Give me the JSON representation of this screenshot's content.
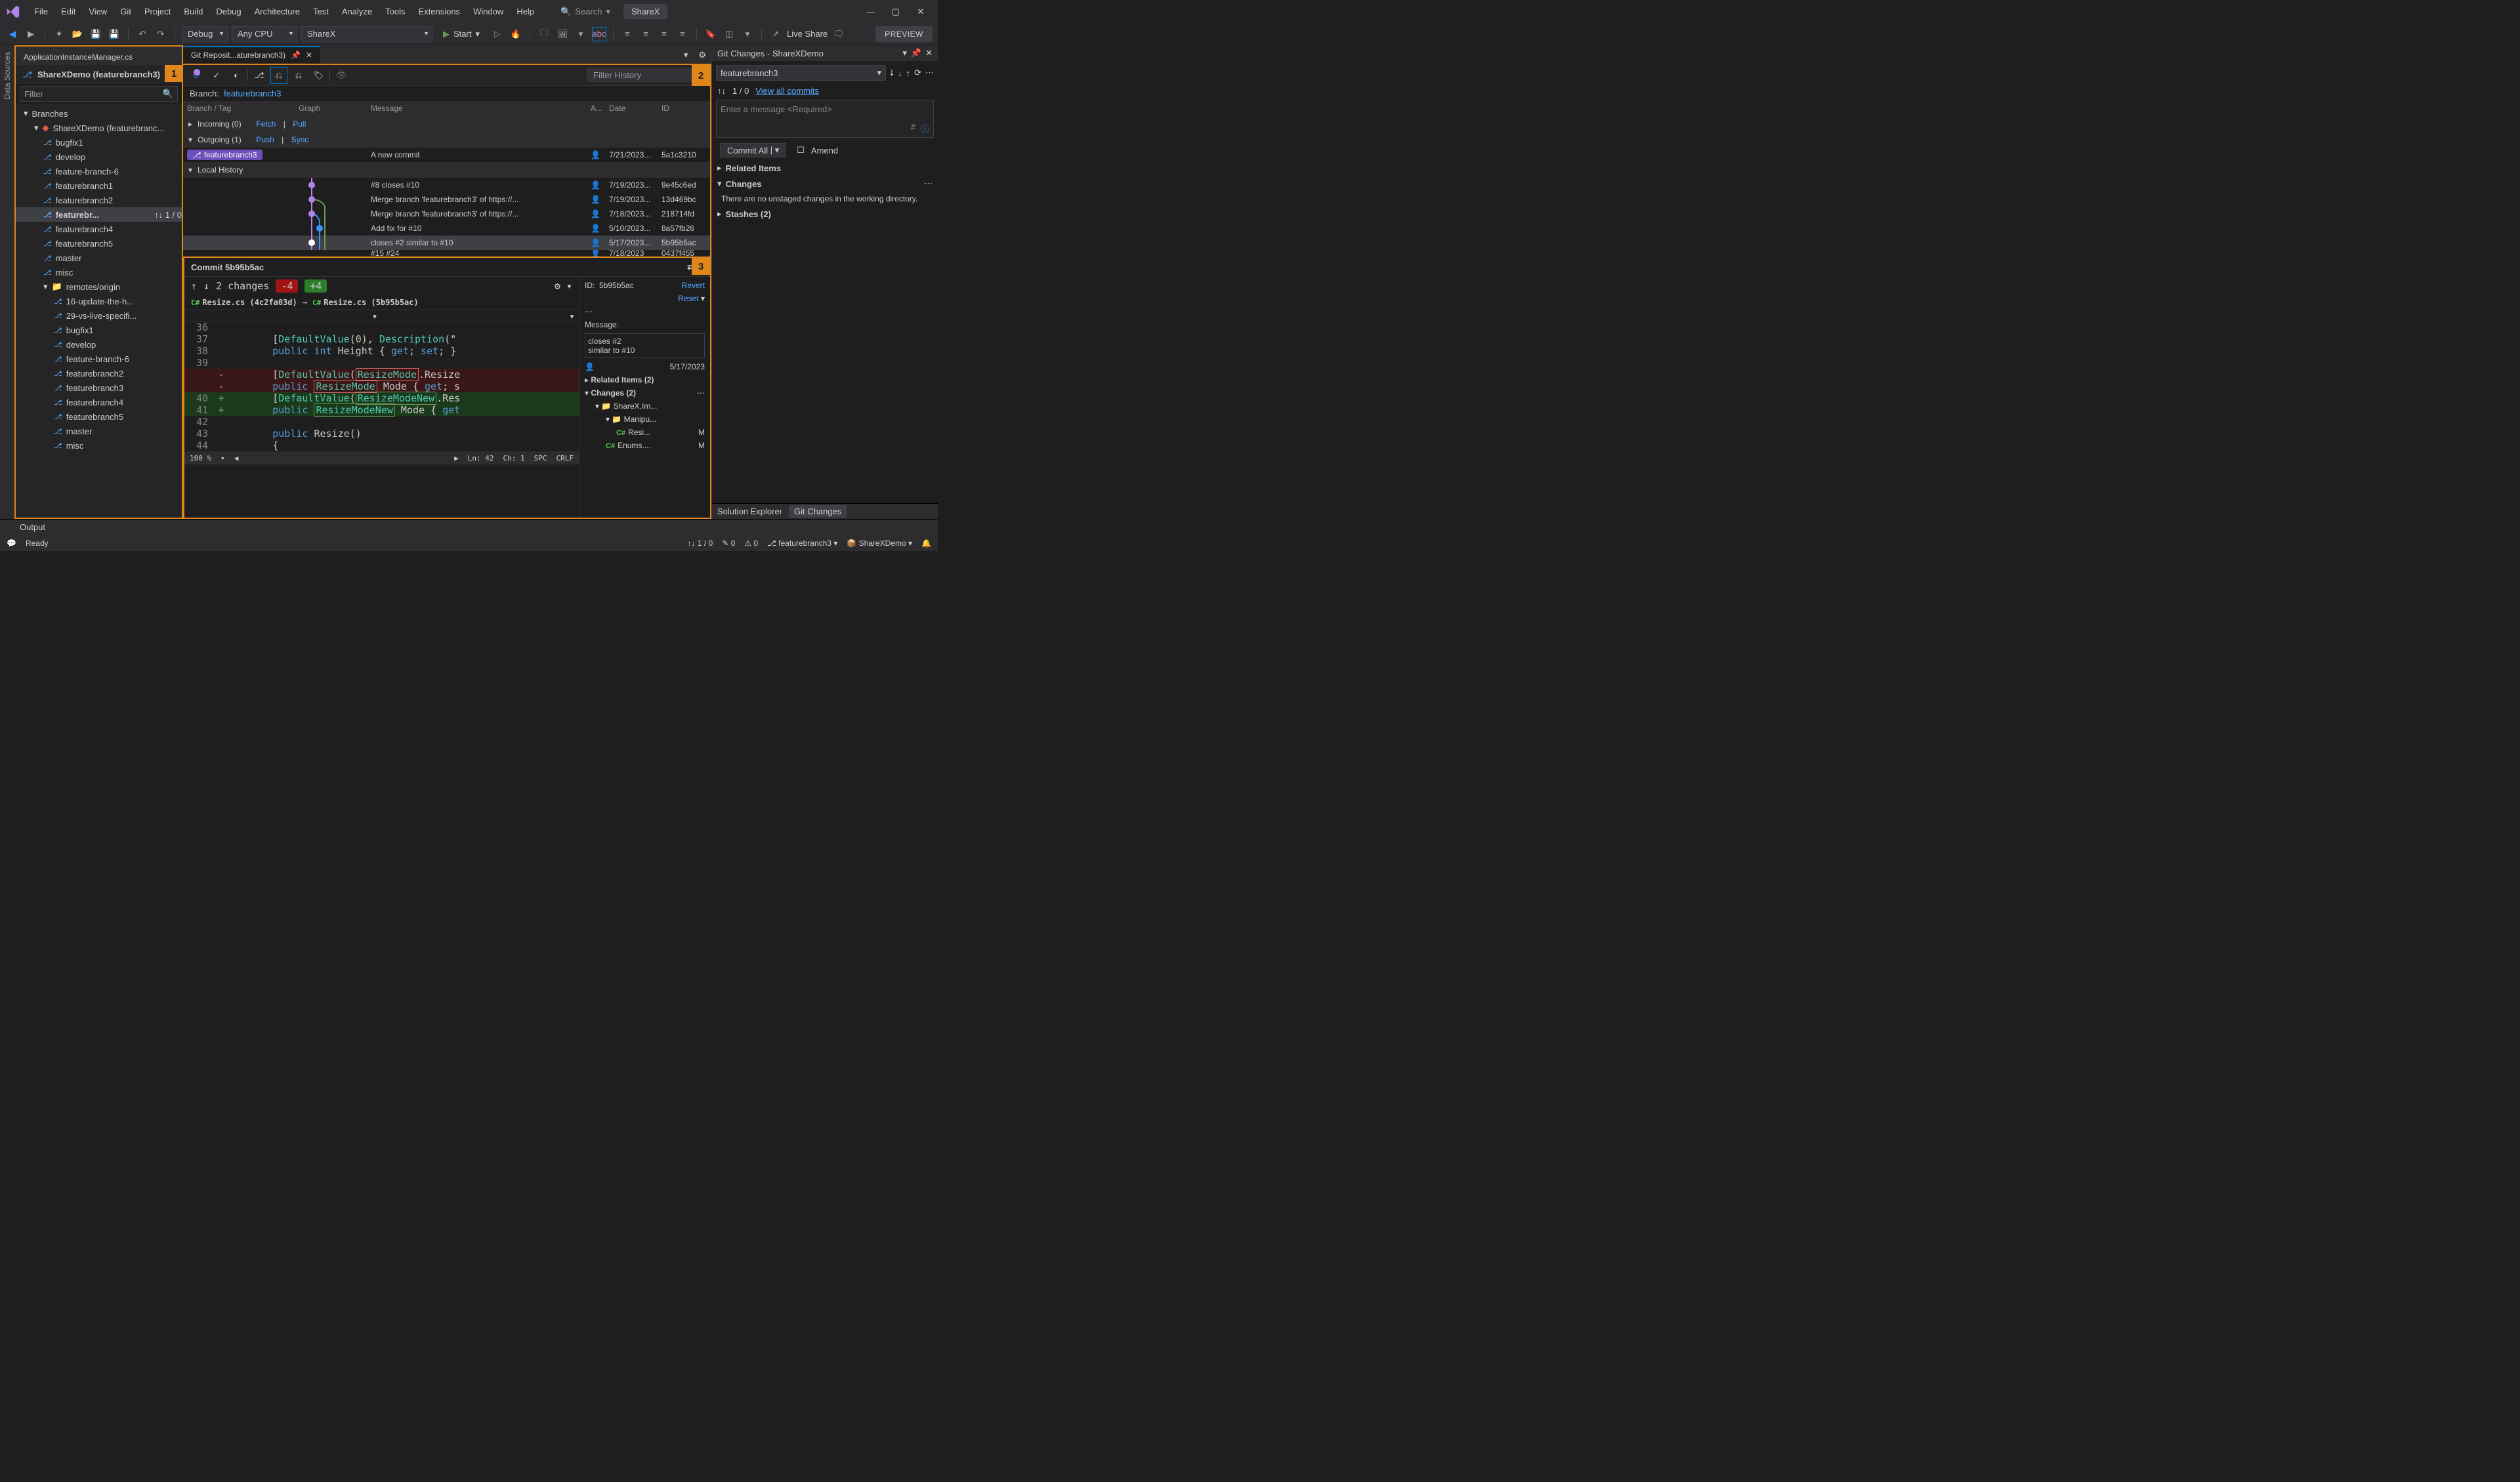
{
  "menu": {
    "file": "File",
    "edit": "Edit",
    "view": "View",
    "git": "Git",
    "project": "Project",
    "build": "Build",
    "debug": "Debug",
    "architecture": "Architecture",
    "test": "Test",
    "analyze": "Analyze",
    "tools": "Tools",
    "extensions": "Extensions",
    "window": "Window",
    "help": "Help",
    "search": "Search"
  },
  "app_name": "ShareX",
  "toolbar": {
    "config": "Debug",
    "platform": "Any CPU",
    "target": "ShareX",
    "start": "Start",
    "live_share": "Live Share",
    "preview": "PREVIEW"
  },
  "sidebar_tab": "Data Sources",
  "doc_tabs": {
    "inactive": "ApplicationInstanceManager.cs",
    "active": "Git Reposit...aturebranch3)"
  },
  "repo_header": "ShareXDemo (featurebranch3)",
  "filter_placeholder": "Filter",
  "tree": {
    "branches_label": "Branches",
    "root": "ShareXDemo (featurebranc...",
    "locals": [
      "bugfix1",
      "develop",
      "feature-branch-6",
      "featurebranch1",
      "featurebranch2",
      "featurebr...",
      "featurebranch4",
      "featurebranch5",
      "master",
      "misc"
    ],
    "selected_suffix": "↑↓ 1 / 0",
    "remotes_label": "remotes/origin",
    "remotes": [
      "16-update-the-h...",
      "29-vs-live-specifi...",
      "bugfix1",
      "develop",
      "feature-branch-6",
      "featurebranch2",
      "featurebranch3",
      "featurebranch4",
      "featurebranch5",
      "master",
      "misc"
    ]
  },
  "repo_toolbar": {
    "filter_history": "Filter History"
  },
  "branch_line": {
    "label": "Branch:",
    "value": "featurebranch3"
  },
  "grid": {
    "headers": {
      "branch": "Branch / Tag",
      "graph": "Graph",
      "message": "Message",
      "author": "A...",
      "date": "Date",
      "id": "ID"
    },
    "incoming": {
      "label": "Incoming (0)",
      "actions": [
        "Fetch",
        "Pull"
      ]
    },
    "outgoing": {
      "label": "Outgoing (1)",
      "actions": [
        "Push",
        "Sync"
      ]
    },
    "out_row": {
      "branch": "featurebranch3",
      "msg": "A new commit",
      "date": "7/21/2023...",
      "id": "5a1c3210"
    },
    "local_history": "Local History",
    "rows": [
      {
        "msg": "#8 closes #10",
        "date": "7/19/2023...",
        "id": "9e45c6ed"
      },
      {
        "msg": "Merge branch 'featurebranch3' of https://...",
        "date": "7/19/2023...",
        "id": "13d469bc"
      },
      {
        "msg": "Merge branch 'featurebranch3' of https://...",
        "date": "7/18/2023...",
        "id": "218714fd"
      },
      {
        "msg": "Add fix for #10",
        "date": "5/10/2023...",
        "id": "8a57fb26"
      },
      {
        "msg": "closes #2 similar to #10",
        "date": "5/17/2023...",
        "id": "5b95b5ac"
      }
    ],
    "cutoff": {
      "msg": "#15 #24",
      "date": "7/18/2023",
      "id": "0437f455"
    }
  },
  "commit": {
    "title": "Commit 5b95b5ac",
    "changes": "2 changes",
    "del": "-4",
    "add": "+4",
    "file_from": "Resize.cs (4c2fa03d)",
    "file_to": "Resize.cs (5b95b5ac)",
    "id_label": "ID:",
    "id": "5b95b5ac",
    "revert": "Revert",
    "reset": "Reset",
    "msg_label": "Message:",
    "msg1": "closes #2",
    "msg2": "similar to #10",
    "date": "5/17/2023",
    "related": "Related Items (2)",
    "changes2": "Changes (2)",
    "tree1": "ShareX.Im...",
    "tree2": "Manipu...",
    "tree3": "Resi...",
    "tree3m": "M",
    "tree4": "Enums....",
    "tree4m": "M",
    "zoom": "100 %",
    "ln": "Ln: 42",
    "ch": "Ch: 1",
    "spc": "SPC",
    "crlf": "CRLF"
  },
  "code": [
    {
      "ln": "36",
      "t": ""
    },
    {
      "ln": "37",
      "t": "        [DefaultValue(0), Description(\""
    },
    {
      "ln": "38",
      "t": "        public int Height { get; set; }"
    },
    {
      "ln": "39",
      "t": ""
    },
    {
      "cls": "del",
      "ln": "",
      "t": "        [DefaultValue(ResizeMode.Resize"
    },
    {
      "cls": "del",
      "ln": "",
      "t": "        public ResizeMode Mode { get; s"
    },
    {
      "cls": "add",
      "ln": "40",
      "t": "        [DefaultValue(ResizeModeNew.Res"
    },
    {
      "cls": "add",
      "ln": "41",
      "t": "        public ResizeModeNew Mode { get"
    },
    {
      "ln": "42",
      "t": ""
    },
    {
      "ln": "43",
      "t": "        public Resize()"
    },
    {
      "ln": "44",
      "t": "        {"
    }
  ],
  "git_changes": {
    "title": "Git Changes - ShareXDemo",
    "branch": "featurebranch3",
    "counts": "1 / 0",
    "view_all": "View all commits",
    "msg_placeholder": "Enter a message <Required>",
    "commit_all": "Commit All",
    "amend": "Amend",
    "related": "Related Items",
    "changes": "Changes",
    "no_changes": "There are no unstaged changes in the working directory.",
    "stashes": "Stashes (2)"
  },
  "bottom": {
    "output": "Output",
    "sol": "Solution Explorer",
    "git": "Git Changes"
  },
  "status": {
    "ready": "Ready",
    "counts": "1 / 0",
    "errors": "0",
    "warnings": "0",
    "branch": "featurebranch3",
    "repo": "ShareXDemo"
  },
  "badges": {
    "b1": "1",
    "b2": "2",
    "b3": "3"
  }
}
